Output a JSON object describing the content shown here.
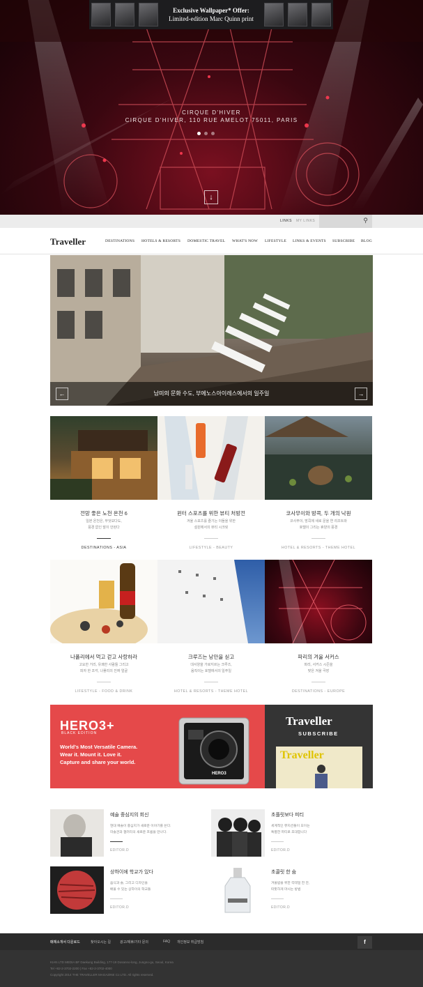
{
  "hero": {
    "promo_line1": "Exclusive Wallpaper* Offer:",
    "promo_line2": "Limited-edition Marc Quinn print",
    "caption_title": "CIRQUE D'HIVER",
    "caption_address": "CIRQUE D'HIVER, 110 RUE AMELOT 75011, PARIS",
    "down_icon": "arrow-down-icon"
  },
  "util": {
    "link1": "LINKS",
    "link2": "MY LINKS",
    "search_icon": "search-icon"
  },
  "nav": {
    "logo": "Traveller",
    "items": [
      "DESTINATIONS",
      "HOTELS & RESORTS",
      "DOMESTIC TRAVEL",
      "WHAT'S NOW",
      "LIFESTYLE",
      "LINKS & EVENTS",
      "SUBSCRIBE",
      "BLOG"
    ]
  },
  "feature": {
    "caption": "남미의 문화 수도, 부에노스아이레스에서의 일주일",
    "prev_icon": "arrow-left-icon",
    "next_icon": "arrow-right-icon"
  },
  "cards": [
    {
      "title": "전망 좋은 노천 온천 6",
      "desc": "일본 온천은, 무엇보다도,\n풍경 없인 말이 안된다",
      "category": "DESTINATIONS - ASIA"
    },
    {
      "title": "윈터 스포츠를 위한 뷰티 처방전",
      "desc": "겨울 스포츠를 즐기는 이들을 위한\n설원에서의 뷰티 시크릿",
      "category": "LIFESTYLE - BEAUTY"
    },
    {
      "title": "코사무이와 방콕, 두 개의 낙원",
      "desc": "코사무이, 방콕에 새로 문을 연 리조트와\n호텔이 그리는 휴양의 풍경",
      "category": "HOTEL & RESORTS - THEME HOTEL"
    },
    {
      "title": "나폴리에서 먹고 걷고 사랑하라",
      "desc": "고요한 거리, 유쾌한 사람들 그리고\n피자 한 조각, 나폴리의 진짜 얼굴",
      "category": "LIFESTYLE - FOOD & DRINK"
    },
    {
      "title": "크루즈는 낭만을 싣고",
      "desc": "대서양을 가로지르는 크루즈,\n움직이는 호텔에서의 일주일",
      "category": "HOTEL & RESORTS - THEME HOTEL"
    },
    {
      "title": "파리의 겨울 서커스",
      "desc": "파리, 서커스 시즌을\n맞은 겨울 극장",
      "category": "DESTINATIONS - EUROPE"
    }
  ],
  "ad": {
    "brand": "HERO3+",
    "edition": "BLACK EDITION",
    "headline": "World's Most Versatile Camera.\nWear it. Mount it. Love it.\nCapture and share your world.",
    "camera_label": "HERO3",
    "subscribe_logo": "Traveller",
    "subscribe_label": "SUBSCRIBE",
    "magazine_title": "Traveller"
  },
  "list": [
    {
      "title": "예술 중심지의 회신",
      "desc": "현대 예술이 중심지가 새로운 이야기를 쓴다.\n미술관과 갤러리의 새로운 흐름을 만나다.",
      "editor": "EDITOR.D"
    },
    {
      "title": "초플릿보다 피티",
      "desc": "세계적인 뮤지션들이 모이는\n특별한 파티로 초대합니다",
      "editor": "EDITOR.D"
    },
    {
      "title": "상하이에 학교가 있다",
      "desc": "음식과 술, 그리고 디자인을\n배울 수 있는 상하이의 학교들",
      "editor": "EDITOR.D"
    },
    {
      "title": "초콜릿 한 숨",
      "desc": "겨울밤을 위한 칵테일 한 잔,\n따뜻하게 마시는 방법",
      "editor": "EDITOR.D"
    }
  ],
  "footer": {
    "links": [
      "매체소개서 다운로드",
      "찾아오시는 길",
      "광고/제휴/기타 문의",
      "FAQ",
      "개인정보 취급방침"
    ],
    "facebook": "f",
    "address1": "KIAN LTD MEDIA BF Daekung Building, 177-19 Dosanno-long, Jungno-gu, Seoul, Korea",
    "address2": "Tel +82-2-3702-2200 | Fax +82-2-3702-4000",
    "copyright": "Copyright 2014 THE TRAVELLER MAGAZINE Co LTD. All rights reserved."
  },
  "colors": {
    "ad_red": "#e5494a",
    "dark": "#2b2b2b",
    "accent": "#222222"
  }
}
